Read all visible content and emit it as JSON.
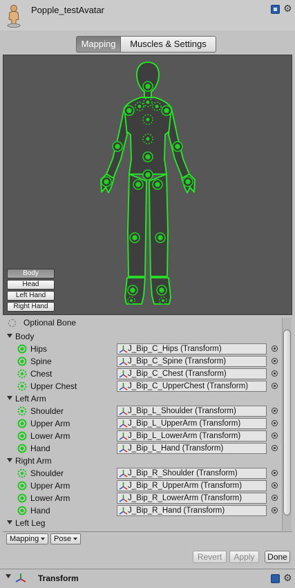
{
  "header": {
    "title": "Popple_testAvatar"
  },
  "tabs": [
    {
      "label": "Mapping",
      "active": true
    },
    {
      "label": "Muscles & Settings",
      "active": false
    }
  ],
  "viewport": {
    "buttons": [
      {
        "label": "Body",
        "active": true
      },
      {
        "label": "Head",
        "active": false
      },
      {
        "label": "Left Hand",
        "active": false
      },
      {
        "label": "Right Hand",
        "active": false
      }
    ]
  },
  "legend": {
    "optional_label": "Optional Bone"
  },
  "groups": [
    {
      "label": "Body",
      "bones": [
        {
          "label": "Hips",
          "value": "J_Bip_C_Hips (Transform)",
          "optional": false
        },
        {
          "label": "Spine",
          "value": "J_Bip_C_Spine (Transform)",
          "optional": false
        },
        {
          "label": "Chest",
          "value": "J_Bip_C_Chest (Transform)",
          "optional": true
        },
        {
          "label": "Upper Chest",
          "value": "J_Bip_C_UpperChest (Transform)",
          "optional": true
        }
      ]
    },
    {
      "label": "Left Arm",
      "bones": [
        {
          "label": "Shoulder",
          "value": "J_Bip_L_Shoulder (Transform)",
          "optional": true
        },
        {
          "label": "Upper Arm",
          "value": "J_Bip_L_UpperArm (Transform)",
          "optional": false
        },
        {
          "label": "Lower Arm",
          "value": "J_Bip_L_LowerArm (Transform)",
          "optional": false
        },
        {
          "label": "Hand",
          "value": "J_Bip_L_Hand (Transform)",
          "optional": false
        }
      ]
    },
    {
      "label": "Right Arm",
      "bones": [
        {
          "label": "Shoulder",
          "value": "J_Bip_R_Shoulder (Transform)",
          "optional": true
        },
        {
          "label": "Upper Arm",
          "value": "J_Bip_R_UpperArm (Transform)",
          "optional": false
        },
        {
          "label": "Lower Arm",
          "value": "J_Bip_R_LowerArm (Transform)",
          "optional": false
        },
        {
          "label": "Hand",
          "value": "J_Bip_R_Hand (Transform)",
          "optional": false
        }
      ]
    },
    {
      "label": "Left Leg",
      "bones": []
    }
  ],
  "bottom_bar": {
    "mapping_label": "Mapping",
    "pose_label": "Pose"
  },
  "actions": {
    "revert": "Revert",
    "apply": "Apply",
    "done": "Done"
  },
  "transform": {
    "label": "Transform"
  },
  "colors": {
    "bone_green": "#22d022",
    "outline_green": "#22ee22",
    "body_fill": "#3e3e3e",
    "viewport_bg": "#575757"
  },
  "icons": {
    "avatar": "avatar-icon",
    "help": "help-icon",
    "settings": "gear-icon",
    "bone_required": "bone-required-icon",
    "bone_optional": "bone-optional-icon",
    "picker": "object-picker-icon",
    "transform": "transform-icon"
  }
}
